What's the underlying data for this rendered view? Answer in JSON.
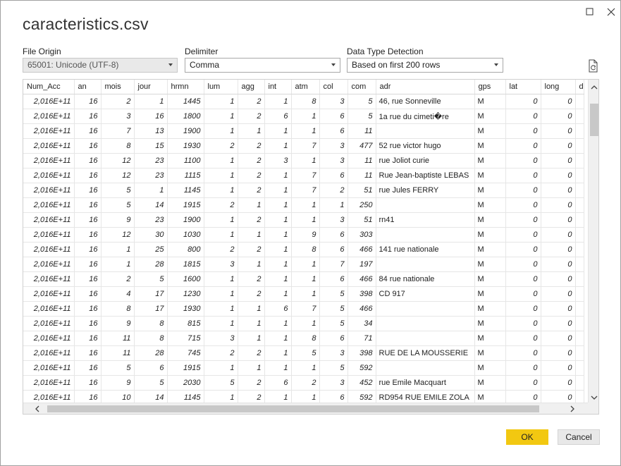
{
  "window": {
    "title": "caracteristics.csv",
    "maximize_icon": "maximize-icon",
    "close_icon": "close-icon"
  },
  "options": {
    "file_origin": {
      "label": "File Origin",
      "value": "65001: Unicode (UTF-8)"
    },
    "delimiter": {
      "label": "Delimiter",
      "value": "Comma"
    },
    "data_type_detection": {
      "label": "Data Type Detection",
      "value": "Based on first 200 rows"
    },
    "refresh_icon": "refresh-file-icon"
  },
  "table": {
    "columns": [
      "Num_Acc",
      "an",
      "mois",
      "jour",
      "hrmn",
      "lum",
      "agg",
      "int",
      "atm",
      "col",
      "com",
      "adr",
      "gps",
      "lat",
      "long",
      "d"
    ],
    "rows": [
      [
        "2,016E+11",
        "16",
        "2",
        "1",
        "1445",
        "1",
        "2",
        "1",
        "8",
        "3",
        "5",
        "46, rue Sonneville",
        "M",
        "0",
        "0"
      ],
      [
        "2,016E+11",
        "16",
        "3",
        "16",
        "1800",
        "1",
        "2",
        "6",
        "1",
        "6",
        "5",
        "1a rue du cimeti�re",
        "M",
        "0",
        "0"
      ],
      [
        "2,016E+11",
        "16",
        "7",
        "13",
        "1900",
        "1",
        "1",
        "1",
        "1",
        "6",
        "11",
        "",
        "M",
        "0",
        "0"
      ],
      [
        "2,016E+11",
        "16",
        "8",
        "15",
        "1930",
        "2",
        "2",
        "1",
        "7",
        "3",
        "477",
        "52 rue victor hugo",
        "M",
        "0",
        "0"
      ],
      [
        "2,016E+11",
        "16",
        "12",
        "23",
        "1100",
        "1",
        "2",
        "3",
        "1",
        "3",
        "11",
        "rue Joliot curie",
        "M",
        "0",
        "0"
      ],
      [
        "2,016E+11",
        "16",
        "12",
        "23",
        "1115",
        "1",
        "2",
        "1",
        "7",
        "6",
        "11",
        "Rue Jean-baptiste LEBAS",
        "M",
        "0",
        "0"
      ],
      [
        "2,016E+11",
        "16",
        "5",
        "1",
        "1145",
        "1",
        "2",
        "1",
        "7",
        "2",
        "51",
        "rue Jules FERRY",
        "M",
        "0",
        "0"
      ],
      [
        "2,016E+11",
        "16",
        "5",
        "14",
        "1915",
        "2",
        "1",
        "1",
        "1",
        "1",
        "250",
        "",
        "M",
        "0",
        "0"
      ],
      [
        "2,016E+11",
        "16",
        "9",
        "23",
        "1900",
        "1",
        "2",
        "1",
        "1",
        "3",
        "51",
        "rn41",
        "M",
        "0",
        "0"
      ],
      [
        "2,016E+11",
        "16",
        "12",
        "30",
        "1030",
        "1",
        "1",
        "1",
        "9",
        "6",
        "303",
        "",
        "M",
        "0",
        "0"
      ],
      [
        "2,016E+11",
        "16",
        "1",
        "25",
        "800",
        "2",
        "2",
        "1",
        "8",
        "6",
        "466",
        "141 rue nationale",
        "M",
        "0",
        "0"
      ],
      [
        "2,016E+11",
        "16",
        "1",
        "28",
        "1815",
        "3",
        "1",
        "1",
        "1",
        "7",
        "197",
        "",
        "M",
        "0",
        "0"
      ],
      [
        "2,016E+11",
        "16",
        "2",
        "5",
        "1600",
        "1",
        "2",
        "1",
        "1",
        "6",
        "466",
        "84 rue nationale",
        "M",
        "0",
        "0"
      ],
      [
        "2,016E+11",
        "16",
        "4",
        "17",
        "1230",
        "1",
        "2",
        "1",
        "1",
        "5",
        "398",
        "CD 917",
        "M",
        "0",
        "0"
      ],
      [
        "2,016E+11",
        "16",
        "8",
        "17",
        "1930",
        "1",
        "1",
        "6",
        "7",
        "5",
        "466",
        "",
        "M",
        "0",
        "0"
      ],
      [
        "2,016E+11",
        "16",
        "9",
        "8",
        "815",
        "1",
        "1",
        "1",
        "1",
        "5",
        "34",
        "",
        "M",
        "0",
        "0"
      ],
      [
        "2,016E+11",
        "16",
        "11",
        "8",
        "715",
        "3",
        "1",
        "1",
        "8",
        "6",
        "71",
        "",
        "M",
        "0",
        "0"
      ],
      [
        "2,016E+11",
        "16",
        "11",
        "28",
        "745",
        "2",
        "2",
        "1",
        "5",
        "3",
        "398",
        "RUE DE LA MOUSSERIE",
        "M",
        "0",
        "0"
      ],
      [
        "2,016E+11",
        "16",
        "5",
        "6",
        "1915",
        "1",
        "1",
        "1",
        "1",
        "5",
        "592",
        "",
        "M",
        "0",
        "0"
      ],
      [
        "2,016E+11",
        "16",
        "9",
        "5",
        "2030",
        "5",
        "2",
        "6",
        "2",
        "3",
        "452",
        "rue Emile Macquart",
        "M",
        "0",
        "0"
      ],
      [
        "2,016E+11",
        "16",
        "10",
        "14",
        "1145",
        "1",
        "2",
        "1",
        "1",
        "6",
        "592",
        "RD954 RUE EMILE ZOLA",
        "M",
        "0",
        "0"
      ]
    ]
  },
  "footer": {
    "ok_label": "OK",
    "cancel_label": "Cancel"
  },
  "colors": {
    "ok_accent": "#f2c811"
  }
}
